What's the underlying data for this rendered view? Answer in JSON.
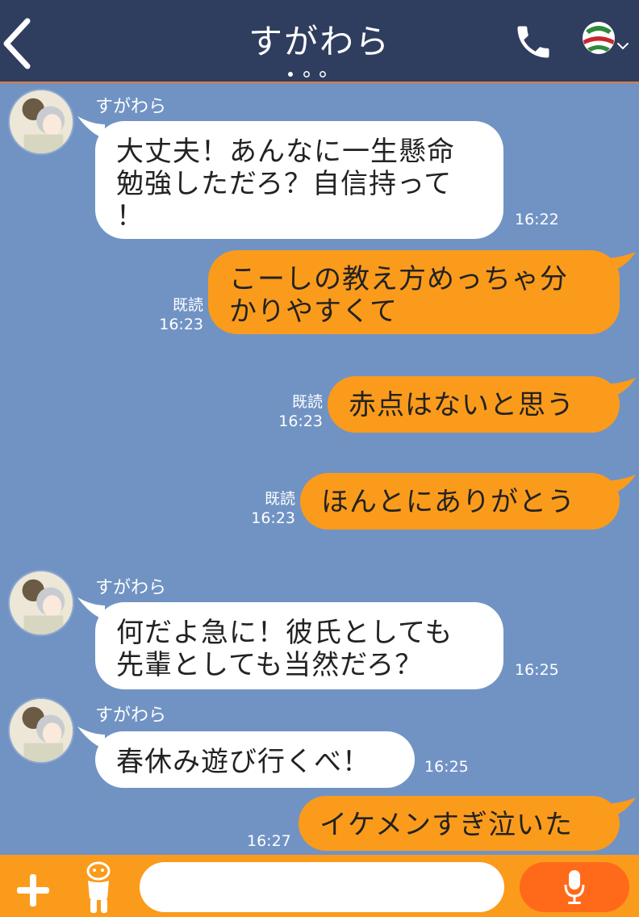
{
  "header": {
    "title": "すがわら",
    "back_icon": "chevron-left-icon",
    "call_icon": "phone-icon",
    "menu_icon": "profile-menu-icon"
  },
  "messages": [
    {
      "direction": "incoming",
      "sender": "すがわら",
      "lines": [
        "大丈夫！あんなに一生懸命",
        "勉強しただろ？自信持って",
        "！"
      ],
      "time": "16:22"
    },
    {
      "direction": "outgoing",
      "read": "既読",
      "lines": [
        "こーしの教え方めっちゃ分",
        "かりやすくて"
      ],
      "time": "16:23"
    },
    {
      "direction": "outgoing",
      "read": "既読",
      "lines": [
        "赤点はないと思う"
      ],
      "time": "16:23"
    },
    {
      "direction": "outgoing",
      "read": "既読",
      "lines": [
        "ほんとにありがとう"
      ],
      "time": "16:23"
    },
    {
      "direction": "incoming",
      "sender": "すがわら",
      "lines": [
        "何だよ急に！彼氏としても",
        "先輩としても当然だろ？"
      ],
      "time": "16:25"
    },
    {
      "direction": "incoming",
      "sender": "すがわら",
      "lines": [
        "春休み遊び行くべ！"
      ],
      "time": "16:25"
    },
    {
      "direction": "outgoing",
      "lines": [
        "イケメンすぎ泣いた"
      ],
      "time": "16:27"
    }
  ],
  "input": {
    "value": "",
    "placeholder": ""
  },
  "colors": {
    "header": "#2f3d5e",
    "background": "#7193c4",
    "outgoing_bubble": "#fb9b1b",
    "incoming_bubble": "#ffffff",
    "mic_button": "#ff6a1a"
  }
}
